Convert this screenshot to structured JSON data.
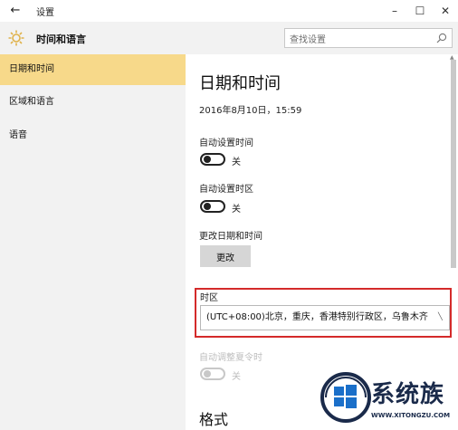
{
  "window": {
    "title": "设置",
    "back_icon": "back-arrow-icon",
    "minimize_glyph": "–",
    "maximize_glyph": "☐",
    "close_glyph": "✕"
  },
  "header": {
    "title": "时间和语言",
    "icon": "gear-icon",
    "search_placeholder": "查找设置"
  },
  "sidebar": {
    "items": [
      {
        "label": "日期和时间",
        "active": true
      },
      {
        "label": "区域和语言",
        "active": false
      },
      {
        "label": "语音",
        "active": false
      }
    ]
  },
  "content": {
    "title": "日期和时间",
    "current_datetime": "2016年8月10日，15:59",
    "auto_time": {
      "label": "自动设置时间",
      "state": "关"
    },
    "auto_timezone": {
      "label": "自动设置时区",
      "state": "关"
    },
    "change_datetime": {
      "label": "更改日期和时间",
      "button": "更改"
    },
    "timezone": {
      "label": "时区",
      "value": "(UTC+08:00)北京，重庆，香港特别行政区，乌鲁木齐",
      "highlight_color": "#d42a2a"
    },
    "dst": {
      "label": "自动调整夏令时",
      "state": "关",
      "disabled": true
    },
    "format_title": "格式"
  },
  "watermark": {
    "text": "系统族",
    "url": "WWW.XITONGZU.COM"
  },
  "colors": {
    "accent": "#f7d98a",
    "sidebar_bg": "#f2f2f2",
    "highlight": "#d42a2a"
  }
}
